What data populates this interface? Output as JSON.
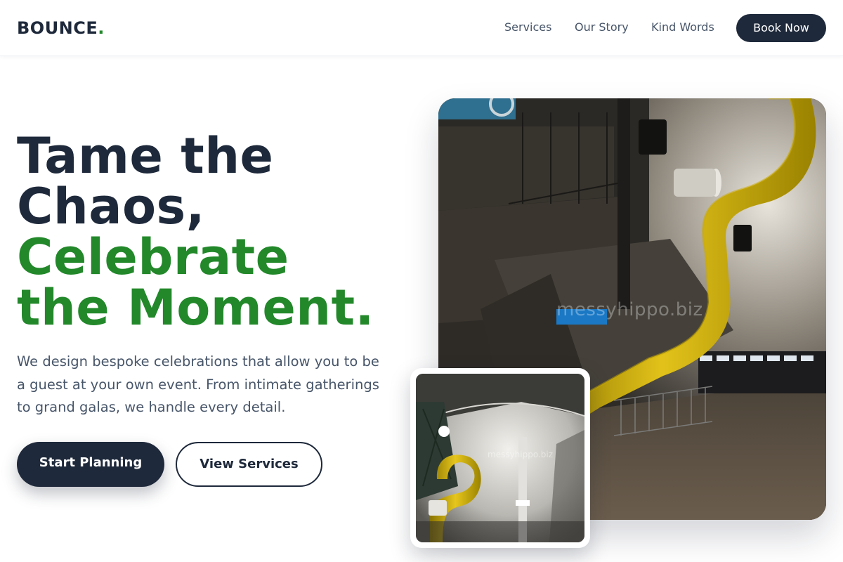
{
  "header": {
    "logo_text": "BOUNCE",
    "logo_dot": ".",
    "nav": {
      "services": "Services",
      "story": "Our Story",
      "words": "Kind Words"
    },
    "cta_label": "Book Now"
  },
  "hero": {
    "headline_line1": "Tame the",
    "headline_line2": "Chaos,",
    "headline_line3": "Celebrate",
    "headline_line4": "the Moment.",
    "subtext": "We design bespoke celebrations that allow you to be a guest at your own event. From intimate gatherings to grand galas, we handle every detail.",
    "primary_button": "Start Planning",
    "secondary_button": "View Services"
  },
  "images": {
    "main_watermark": "messyhippo.biz",
    "inset_watermark": "messyhippo.biz"
  },
  "colors": {
    "primary_dark": "#1e293b",
    "accent_green": "#22882a",
    "body_text": "#475569"
  }
}
